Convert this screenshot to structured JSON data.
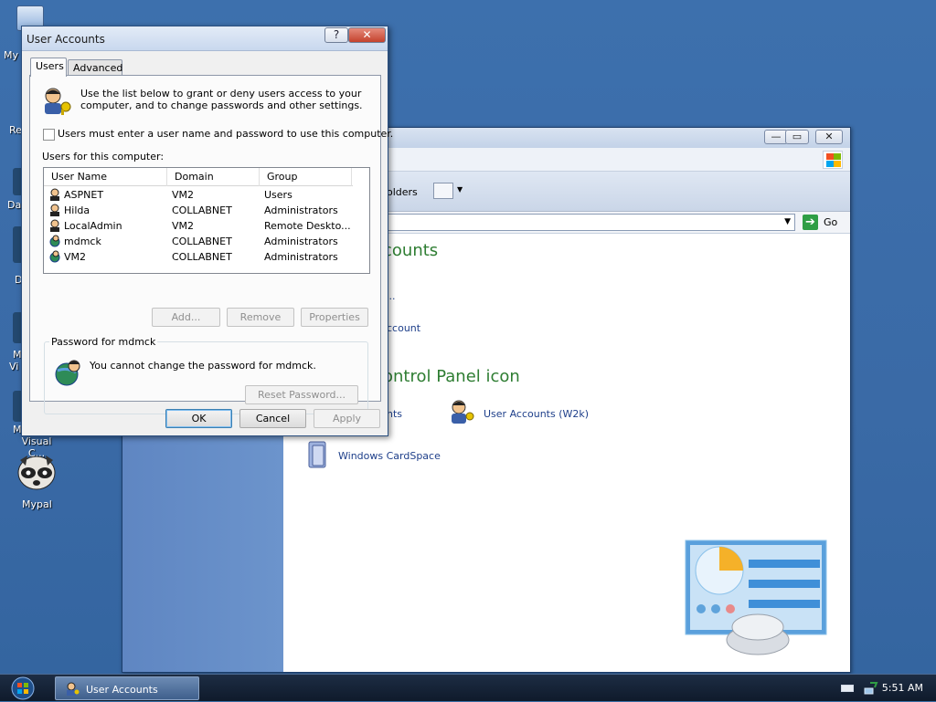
{
  "desktop": {
    "icons": [
      {
        "label": "My"
      },
      {
        "label": "Re"
      },
      {
        "label": "Da"
      },
      {
        "label": "D"
      },
      {
        "label": "M"
      },
      {
        "label": "Vi"
      },
      {
        "label": "M"
      },
      {
        "label": "Visual C..."
      },
      {
        "label": "Mypal"
      }
    ]
  },
  "cp": {
    "toolbar_text": "olders",
    "go_label": "Go",
    "heading1": "counts",
    "link_dots": "...",
    "link_account": "ccount",
    "heading2": "ontrol Panel icon",
    "link_nts": "nts",
    "link_w2k": "User Accounts (W2k)",
    "link_cardspace": "Windows CardSpace"
  },
  "dialog": {
    "title": "User Accounts",
    "help_glyph": "?",
    "close_glyph": "✕",
    "tabs": [
      {
        "label": "Users"
      },
      {
        "label": "Advanced"
      }
    ],
    "intro": [
      "Use the list below to grant or deny users access to your",
      "computer, and to change passwords and other settings."
    ],
    "checkbox_label": "Users must enter a user name and password to use this computer.",
    "users_label": "Users for this computer:",
    "columns": [
      "User Name",
      "Domain",
      "Group"
    ],
    "rows": [
      {
        "name": "ASPNET",
        "domain": "VM2",
        "group": "Users"
      },
      {
        "name": "Hilda",
        "domain": "COLLABNET",
        "group": "Administrators"
      },
      {
        "name": "LocalAdmin",
        "domain": "VM2",
        "group": "Remote Deskto..."
      },
      {
        "name": "mdmck",
        "domain": "COLLABNET",
        "group": "Administrators"
      },
      {
        "name": "VM2",
        "domain": "COLLABNET",
        "group": "Administrators"
      }
    ],
    "btn_add": "Add...",
    "btn_remove": "Remove",
    "btn_properties": "Properties",
    "password_group": "Password for mdmck",
    "password_msg": "You cannot change the password for mdmck.",
    "btn_reset": "Reset Password...",
    "btn_ok": "OK",
    "btn_cancel": "Cancel",
    "btn_apply": "Apply"
  },
  "taskbar": {
    "task_label": "User Accounts",
    "clock": "5:51 AM"
  },
  "colors": {
    "desktop": "#3a6ea5",
    "heading_green": "#2e7d32",
    "link_blue": "#1e3f8a"
  }
}
